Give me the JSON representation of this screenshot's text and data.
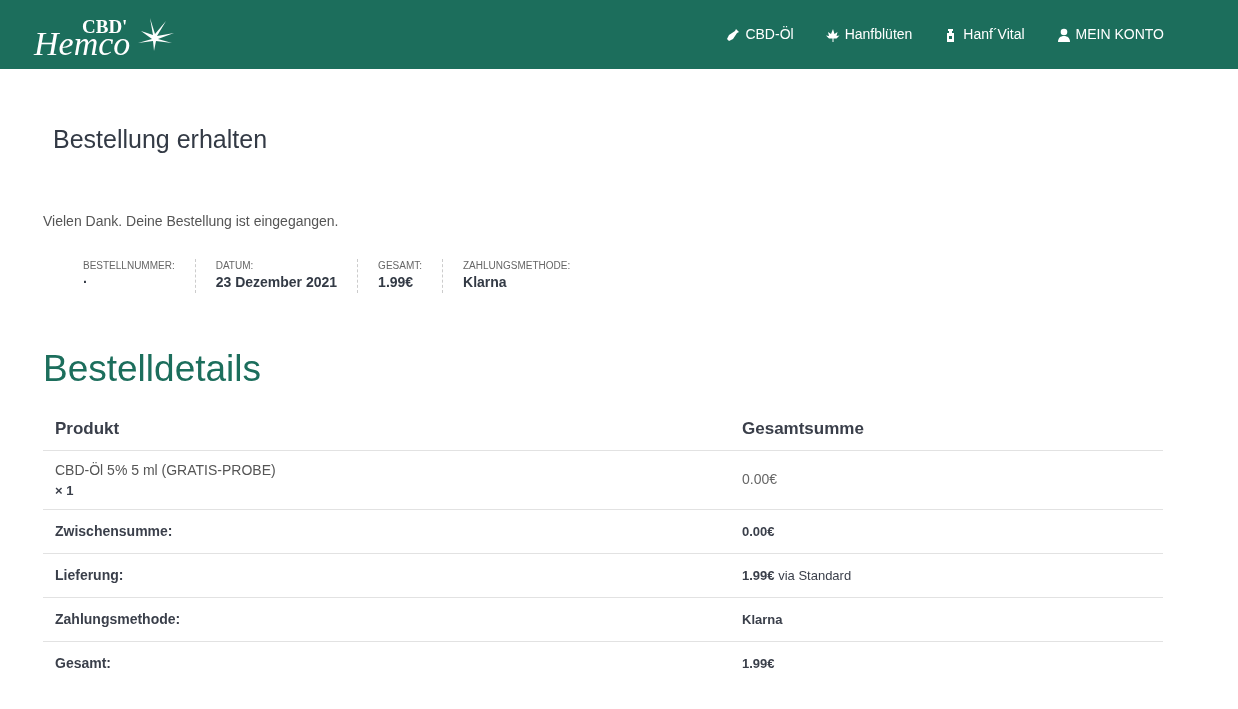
{
  "header": {
    "logo": {
      "top": "CBD'",
      "script": "Hemco"
    },
    "nav": [
      {
        "label": "CBD-Öl",
        "kind": "bottle"
      },
      {
        "label": "Hanfblüten",
        "kind": "leaf"
      },
      {
        "label": "Hanf´Vital",
        "kind": "dispenser"
      },
      {
        "label": "MEIN KONTO",
        "kind": "user"
      }
    ]
  },
  "page_title": "Bestellung erhalten",
  "notice": "Vielen Dank. Deine Bestellung ist eingegangen.",
  "overview": [
    {
      "label": "BESTELLNUMMER:",
      "value": "·"
    },
    {
      "label": "DATUM:",
      "value": "23 Dezember 2021"
    },
    {
      "label": "GESAMT:",
      "value": "1.99€"
    },
    {
      "label": "ZAHLUNGSMETHODE:",
      "value": "Klarna"
    }
  ],
  "details": {
    "title": "Bestelldetails",
    "columns": [
      "Produkt",
      "Gesamtsumme"
    ],
    "items": [
      {
        "name": "CBD-Öl 5% 5 ml (GRATIS-PROBE)",
        "quantity": "× 1",
        "total": "0.00€"
      }
    ],
    "totals": [
      {
        "label": "Zwischensumme:",
        "value": "**0.00€**"
      },
      {
        "label": "Lieferung:",
        "value": "**1.99€** via Standard"
      },
      {
        "label": "Zahlungsmethode:",
        "value": "**Klarna**"
      },
      {
        "label": "Gesamt:",
        "value": "**1.99€**"
      }
    ]
  }
}
